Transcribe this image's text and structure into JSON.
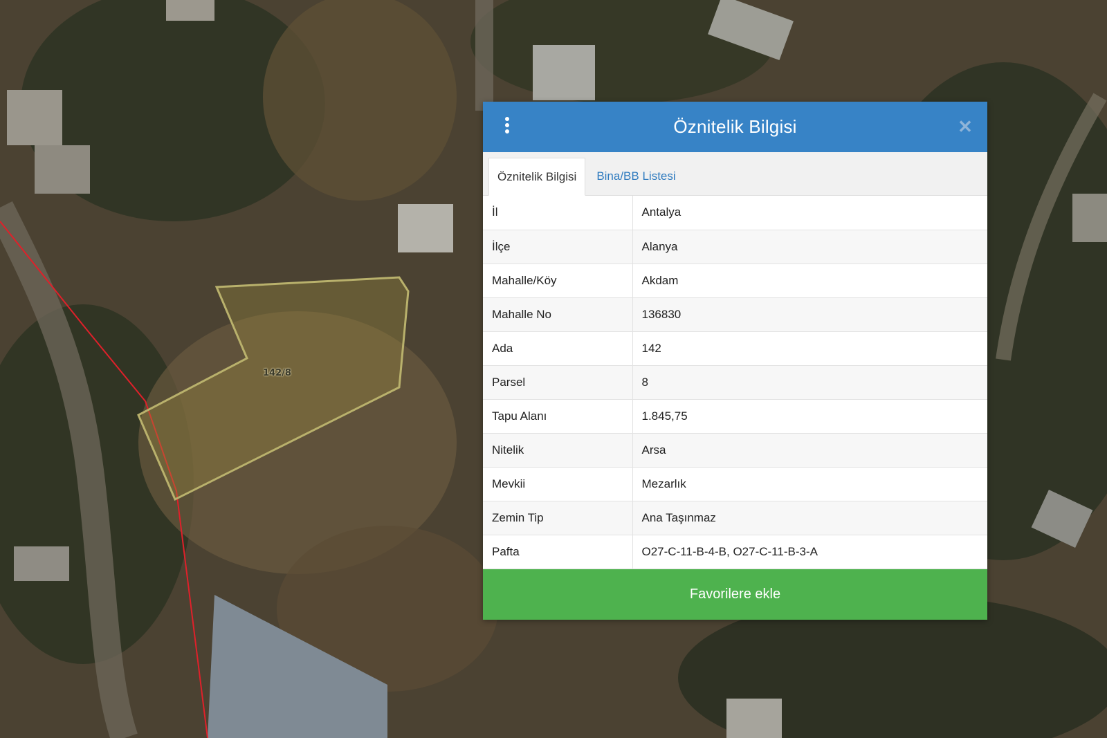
{
  "map": {
    "parcel_label": "142/8"
  },
  "panel": {
    "title": "Öznitelik Bilgisi",
    "menu_icon": "vertical-ellipsis-icon",
    "close_icon": "close-icon",
    "tabs": [
      {
        "label": "Öznitelik Bilgisi",
        "active": true
      },
      {
        "label": "Bina/BB Listesi",
        "active": false
      }
    ],
    "rows": [
      {
        "key": "İl",
        "value": "Antalya"
      },
      {
        "key": "İlçe",
        "value": "Alanya"
      },
      {
        "key": "Mahalle/Köy",
        "value": "Akdam"
      },
      {
        "key": "Mahalle No",
        "value": "136830"
      },
      {
        "key": "Ada",
        "value": "142"
      },
      {
        "key": "Parsel",
        "value": "8"
      },
      {
        "key": "Tapu Alanı",
        "value": "1.845,75"
      },
      {
        "key": "Nitelik",
        "value": "Arsa"
      },
      {
        "key": "Mevkii",
        "value": "Mezarlık"
      },
      {
        "key": "Zemin Tip",
        "value": "Ana Taşınmaz"
      },
      {
        "key": "Pafta",
        "value": "O27-C-11-B-4-B, O27-C-11-B-3-A"
      }
    ],
    "favorite_button": "Favorilere ekle"
  },
  "colors": {
    "header": "#3783c6",
    "tab_link": "#2f7bbf",
    "button": "#4eb24e",
    "parcel_outline": "#b9b16c",
    "boundary_line": "#e0202a"
  }
}
